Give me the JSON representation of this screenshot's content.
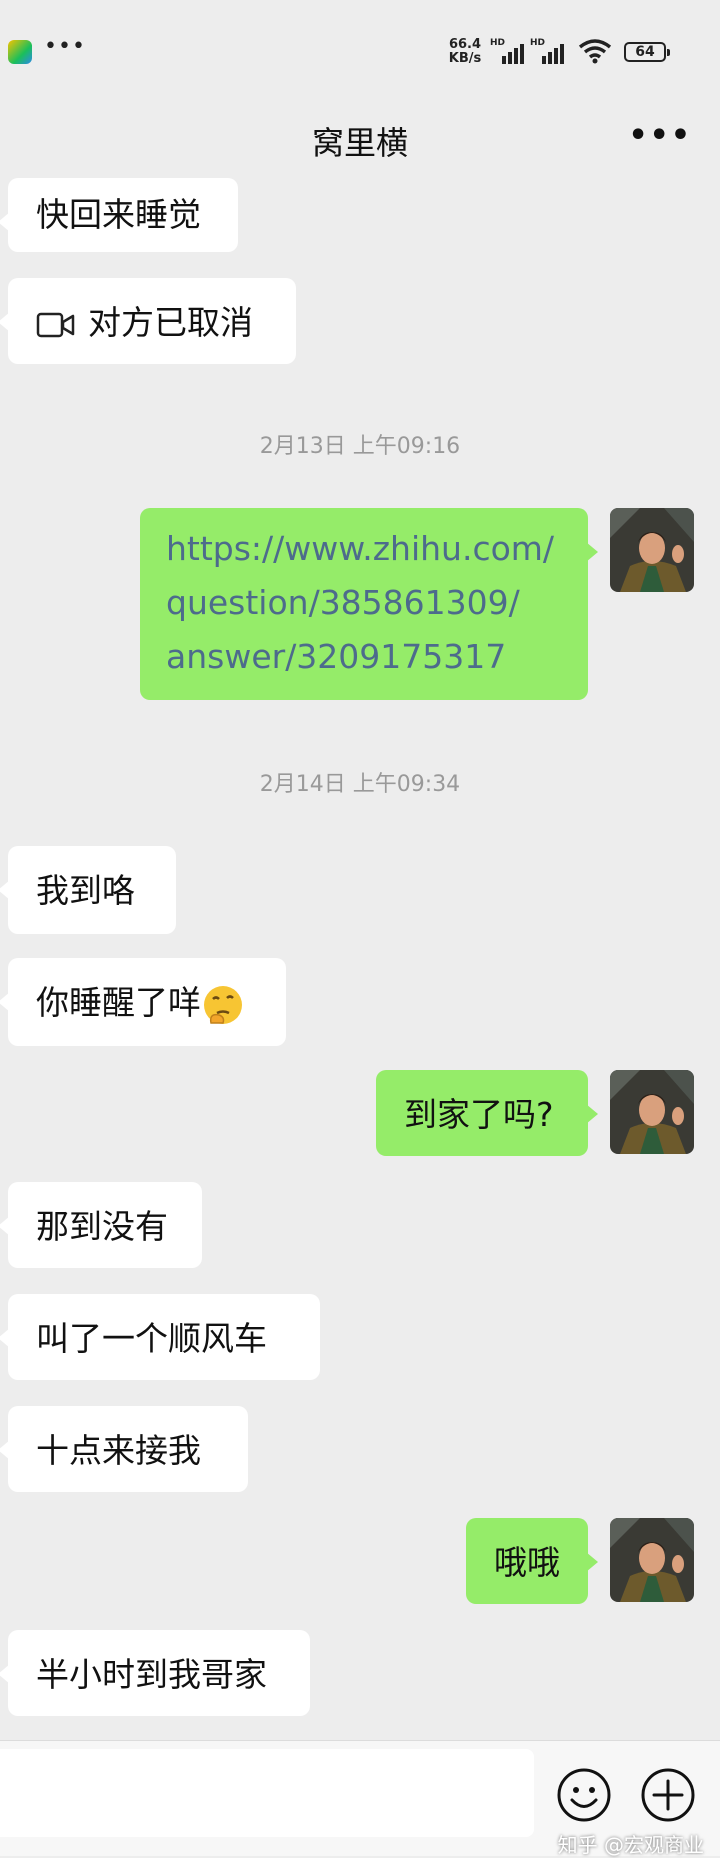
{
  "status_bar": {
    "net_speed_value": "66.4",
    "net_speed_unit": "KB/s",
    "hd_label": "HD",
    "battery_level": "64",
    "overflow_glyph": "•••"
  },
  "header": {
    "title": "窝里横",
    "more_glyph": "•••"
  },
  "messages": [
    {
      "side": "in",
      "text": "快回来睡觉"
    },
    {
      "side": "in",
      "type": "video-call",
      "text": "对方已取消"
    },
    {
      "type": "timestamp",
      "text": "2月13日 上午09:16"
    },
    {
      "side": "out",
      "type": "link",
      "text": "https://www.zhihu.com/\nquestion/385861309/\nanswer/3209175317"
    },
    {
      "type": "timestamp",
      "text": "2月14日 上午09:34"
    },
    {
      "side": "in",
      "text": "我到咯"
    },
    {
      "side": "in",
      "text": "你睡醒了咩",
      "emoji": "thinking-face"
    },
    {
      "side": "out",
      "text": "到家了吗?"
    },
    {
      "side": "in",
      "text": "那到没有"
    },
    {
      "side": "in",
      "text": "叫了一个顺风车"
    },
    {
      "side": "in",
      "text": "十点来接我"
    },
    {
      "side": "out",
      "text": "哦哦"
    },
    {
      "side": "in",
      "text": "半小时到我哥家"
    }
  ],
  "input_bar": {
    "placeholder": "",
    "emoji_icon": "smiley-icon",
    "plus_icon": "plus-circle-icon"
  },
  "watermark": "知乎 @宏观商业",
  "colors": {
    "background": "#ededed",
    "outgoing_bubble": "#95ec69",
    "incoming_bubble": "#ffffff",
    "link_text": "#4d6b8c"
  }
}
